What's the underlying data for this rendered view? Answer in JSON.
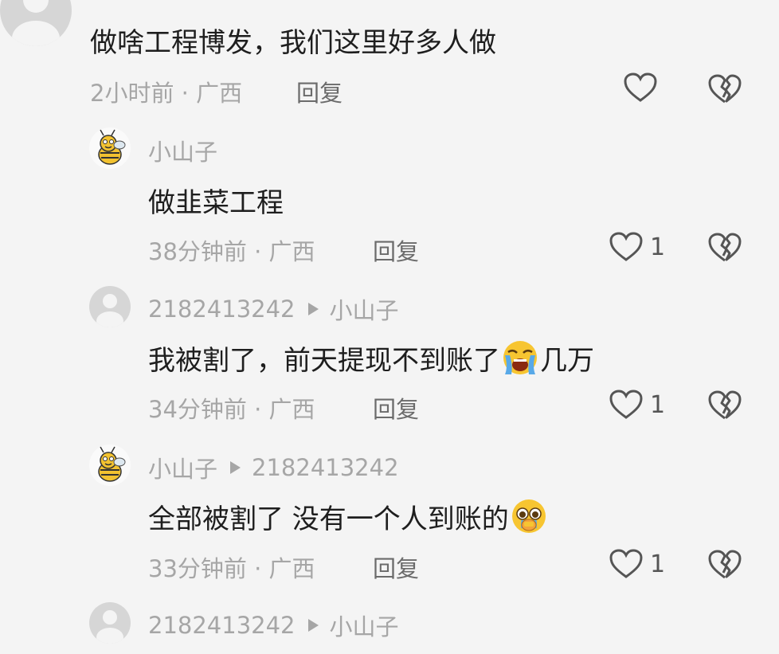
{
  "comments": [
    {
      "text": "做啥工程博发，我们这里好多人做",
      "time": "2小时前 · 广西",
      "reply": "回复"
    },
    {
      "user": "小山子",
      "text": "做韭菜工程",
      "time": "38分钟前 · 广西",
      "reply": "回复",
      "likes": "1"
    },
    {
      "user": "2182413242",
      "reply_to": "小山子",
      "text_before": "我被割了，前天提现不到账了",
      "text_after": "几万",
      "emoji": "loudly-crying-emoji",
      "time": "34分钟前 · 广西",
      "reply": "回复",
      "likes": "1"
    },
    {
      "user": "小山子",
      "reply_to": "2182413242",
      "text_before": "全部被割了 没有一个人到账的",
      "emoji": "pleading-crying-emoji",
      "time": "33分钟前 · 广西",
      "reply": "回复",
      "likes": "1"
    },
    {
      "user": "2182413242",
      "reply_to": "小山子"
    }
  ],
  "icons": {
    "like": "heart-outline-icon",
    "dislike": "broken-heart-icon"
  },
  "colors": {
    "background": "#f4f4f4",
    "text": "#1e1e1e",
    "meta": "#a6a6a6"
  }
}
